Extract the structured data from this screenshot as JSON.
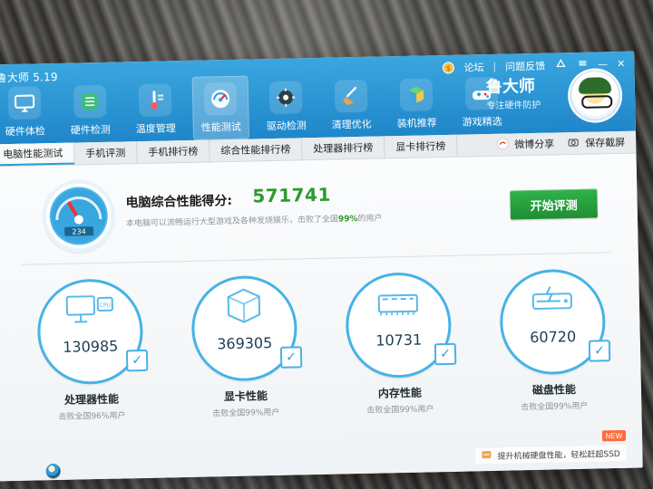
{
  "window": {
    "title": "鲁大师 5.19"
  },
  "top_controls": {
    "forum": "论坛",
    "feedback": "问题反馈",
    "minimize_symbol": "—",
    "close_symbol": "✕"
  },
  "brand": {
    "name": "鲁大师",
    "slogan": "专注硬件防护"
  },
  "nav": [
    {
      "label": "硬件体检",
      "icon": "monitor-icon"
    },
    {
      "label": "硬件检测",
      "icon": "circuit-board-icon"
    },
    {
      "label": "温度管理",
      "icon": "thermometer-icon"
    },
    {
      "label": "性能测试",
      "icon": "speedometer-icon",
      "active": true
    },
    {
      "label": "驱动检测",
      "icon": "driver-gear-icon"
    },
    {
      "label": "清理优化",
      "icon": "broom-icon"
    },
    {
      "label": "装机推荐",
      "icon": "cube-icon"
    },
    {
      "label": "游戏精选",
      "icon": "gamepad-icon"
    }
  ],
  "subtabs": {
    "items": [
      {
        "label": "电脑性能测试",
        "active": true
      },
      {
        "label": "手机评测"
      },
      {
        "label": "手机排行榜"
      },
      {
        "label": "综合性能排行榜"
      },
      {
        "label": "处理器排行榜"
      },
      {
        "label": "显卡排行榜"
      }
    ],
    "right": {
      "weibo_share": "微博分享",
      "save_screenshot": "保存截屏"
    }
  },
  "score": {
    "title": "电脑综合性能得分:",
    "value": "571741",
    "desc_prefix": "本电脑可以流畅运行大型游戏及各种发烧娱乐，击败了全国",
    "desc_percent": "99%",
    "desc_suffix": "的用户",
    "start_button": "开始评测",
    "gauge_readout": "234"
  },
  "cards": [
    {
      "value": "130985",
      "title": "处理器性能",
      "sub": "击败全国96%用户",
      "icon": "cpu-icon"
    },
    {
      "value": "369305",
      "title": "显卡性能",
      "sub": "击败全国99%用户",
      "icon": "gpu-3d-icon"
    },
    {
      "value": "10731",
      "title": "内存性能",
      "sub": "击败全国99%用户",
      "icon": "memory-icon"
    },
    {
      "value": "60720",
      "title": "磁盘性能",
      "sub": "击败全国99%用户",
      "icon": "disk-icon"
    }
  ],
  "upgrade": {
    "badge": "NEW",
    "text": "提升机械硬盘性能，轻松赶超SSD"
  }
}
